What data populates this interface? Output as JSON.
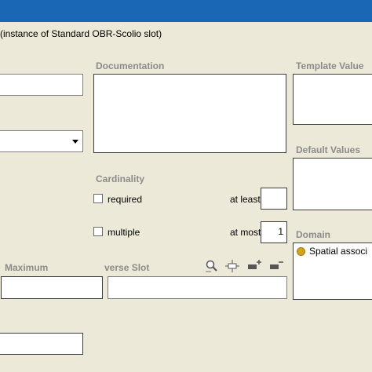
{
  "window": {
    "subtitle": "(instance of Standard OBR-Scolio slot)"
  },
  "labels": {
    "documentation": "Documentation",
    "template_values": "Template Value",
    "default_values": "Default Values",
    "cardinality": "Cardinality",
    "required": "required",
    "multiple": "multiple",
    "at_least": "at least",
    "at_most": "at most",
    "domain": "Domain",
    "maximum": "Maximum",
    "inverse_slot": "verse Slot"
  },
  "values": {
    "at_least": "",
    "at_most": "1"
  },
  "domain": {
    "items": [
      "Spatial associ"
    ]
  },
  "icons": [
    "find-icon",
    "slot-icon",
    "add-icon",
    "remove-icon"
  ],
  "colors": {
    "title_bar": "#1a67b5",
    "domain_dot": "#d4a21b"
  }
}
